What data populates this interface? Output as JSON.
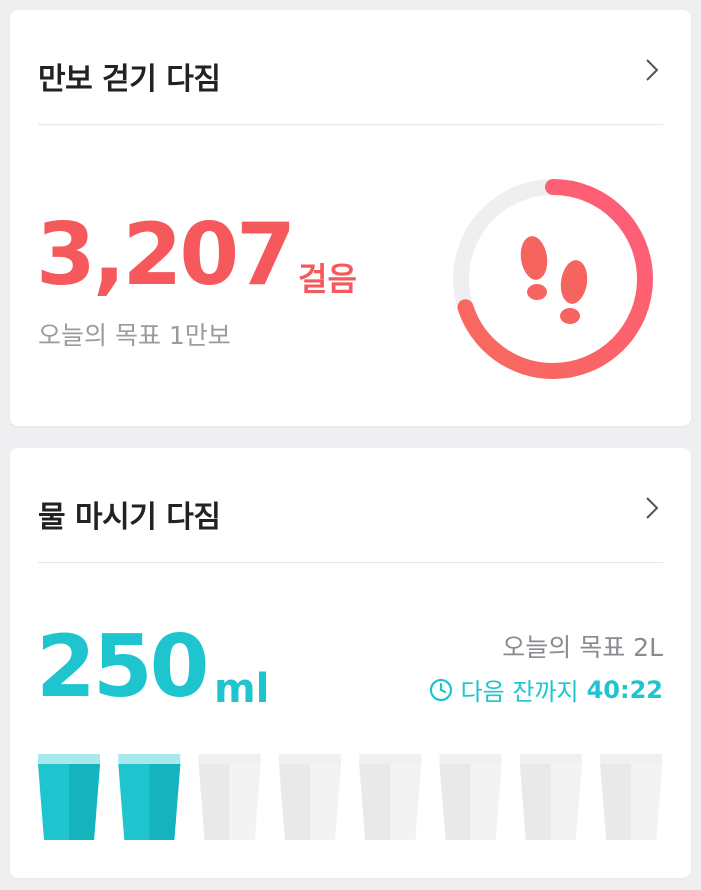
{
  "steps_card": {
    "title": "만보 걷기 다짐",
    "value": "3,207",
    "unit": "걸음",
    "goal_label": "오늘의 목표 1만보",
    "progress": 0.3207,
    "accent_color": "#f5595c",
    "ring_icon": "footsteps-icon"
  },
  "water_card": {
    "title": "물 마시기 다짐",
    "value": "250",
    "unit": "ml",
    "goal_label": "오늘의 목표 2L",
    "next_label": "다음 잔까지",
    "next_time": "40:22",
    "accent_color": "#1ec5cf",
    "cups_total": 8,
    "cups_filled": 2
  }
}
